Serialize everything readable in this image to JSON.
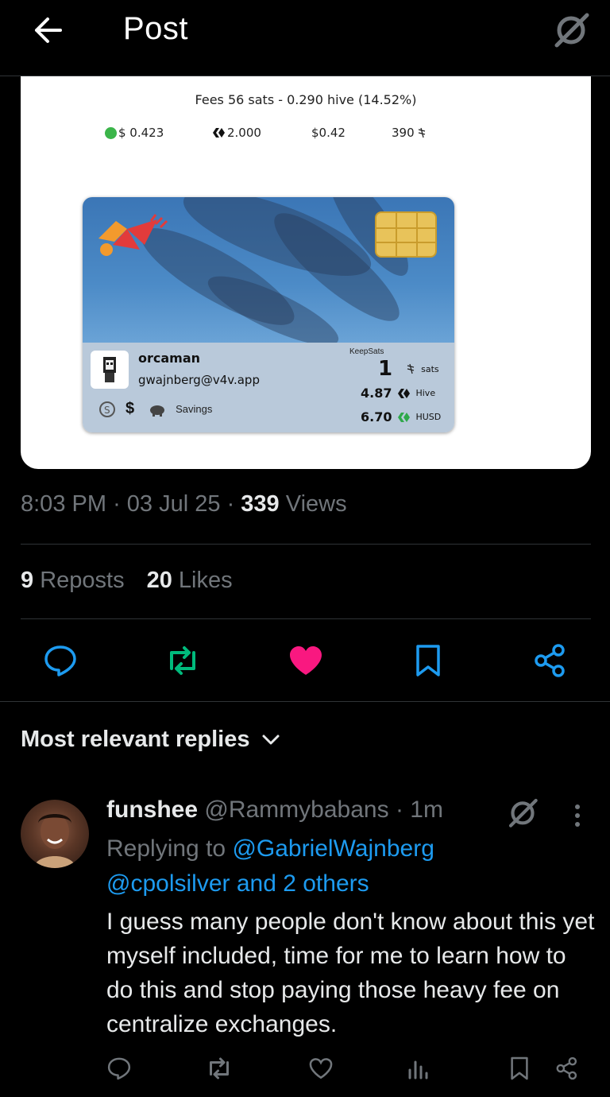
{
  "header": {
    "title": "Post"
  },
  "media": {
    "fees_line": "Fees 56 sats - 0.290 hive (14.52%)",
    "fee_values": [
      "$ 0.423",
      "2.000",
      "$0.42",
      "390"
    ],
    "card": {
      "name": "orcaman",
      "email": "gwajnberg@v4v.app",
      "savings_label": "Savings",
      "dollar_label": "$",
      "keepsats_label": "KeepSats",
      "sats_value": "1",
      "sats_unit": "sats",
      "hive_value": "4.87",
      "hive_unit": "Hive",
      "husd_value": "6.70",
      "husd_unit": "HUSD"
    }
  },
  "meta": {
    "time": "8:03 PM",
    "date": "03 Jul 25",
    "views_count": "339",
    "views_label": "Views",
    "sep": "·"
  },
  "stats": {
    "reposts_count": "9",
    "reposts_label": "Reposts",
    "likes_count": "20",
    "likes_label": "Likes"
  },
  "replies_header": "Most relevant replies",
  "reply": {
    "name": "funshee",
    "handle": "@Rammybabans",
    "time": "1m",
    "replying_to_label": "Replying to",
    "mention_1": "@GabrielWajnberg",
    "mention_2": "@cpolsilver and 2 others",
    "text": "I guess many people don't know about this yet myself included, time for me to learn how to do this and stop paying those heavy fee on centralize exchanges."
  },
  "colors": {
    "accent": "#1d9bf0",
    "repost_active": "#00ba7c",
    "like_active": "#f91880",
    "muted": "#71767b"
  }
}
